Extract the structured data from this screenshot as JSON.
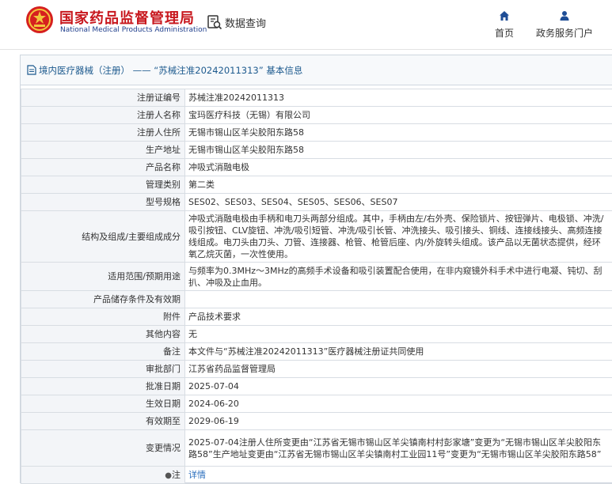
{
  "header": {
    "brand_cn": "国家药品监督管理局",
    "brand_en": "National Medical Products Administration",
    "query_label": "数据查询",
    "nav": [
      {
        "label": "首页",
        "icon": "home-icon"
      },
      {
        "label": "政务服务门户",
        "icon": "user-icon"
      }
    ]
  },
  "colors": {
    "brand_red": "#c8181e",
    "brand_blue": "#1f3e8c",
    "link_blue": "#2a6ebd",
    "title_blue": "#1d5a8e"
  },
  "panel": {
    "title": "境内医疗器械（注册） —— “苏械注准20242011313” 基本信息",
    "icon": "document-icon"
  },
  "rows": [
    {
      "key": "注册证编号",
      "value": "苏械注准20242011313"
    },
    {
      "key": "注册人名称",
      "value": "宝玛医疗科技（无锡）有限公司"
    },
    {
      "key": "注册人住所",
      "value": "无锡市锡山区羊尖胶阳东路58"
    },
    {
      "key": "生产地址",
      "value": "无锡市锡山区羊尖胶阳东路58"
    },
    {
      "key": "产品名称",
      "value": "冲吸式消融电极"
    },
    {
      "key": "管理类别",
      "value": "第二类"
    },
    {
      "key": "型号规格",
      "value": "SES02、SES03、SES04、SES05、SES06、SES07"
    },
    {
      "key": "结构及组成/主要组成成分",
      "value": "冲吸式消融电极由手柄和电刀头两部分组成。其中，手柄由左/右外壳、保险锁片、按钮弹片、电极锁、冲洗/吸引按钮、CLV旋钮、冲洗/吸引短管、冲洗/吸引长管、冲洗接头、吸引接头、铜线、连接线接头、高频连接线组成。电刀头由刀头、刀管、连接器、枪管、枪管后座、内/外旋转头组成。该产品以无菌状态提供，经环氧乙烷灭菌，一次性使用。"
    },
    {
      "key": "适用范围/预期用途",
      "value": "与频率为0.3MHz～3MHz的高频手术设备和吸引装置配合使用，在非内窥镜外科手术中进行电凝、钝切、刮扒、冲吸及止血用。"
    },
    {
      "key": "产品储存条件及有效期",
      "value": ""
    },
    {
      "key": "附件",
      "value": "产品技术要求"
    },
    {
      "key": "其他内容",
      "value": "无"
    },
    {
      "key": "备注",
      "value": "本文件与“苏械注准20242011313”医疗器械注册证共同使用"
    },
    {
      "key": "审批部门",
      "value": "江苏省药品监督管理局"
    },
    {
      "key": "批准日期",
      "value": "2025-07-04"
    },
    {
      "key": "生效日期",
      "value": "2024-06-20"
    },
    {
      "key": "有效期至",
      "value": "2029-06-19"
    },
    {
      "key": "变更情况",
      "value": "2025-07-04注册人住所变更由“江苏省无锡市锡山区羊尖镇南村村彭家塘”变更为“无锡市锡山区羊尖胶阳东路58”生产地址变更由“江苏省无锡市锡山区羊尖镇南村工业园11号”变更为“无锡市锡山区羊尖胶阳东路58”"
    }
  ],
  "note": {
    "pin_glyph": "●",
    "key": "注",
    "link": "详情"
  }
}
